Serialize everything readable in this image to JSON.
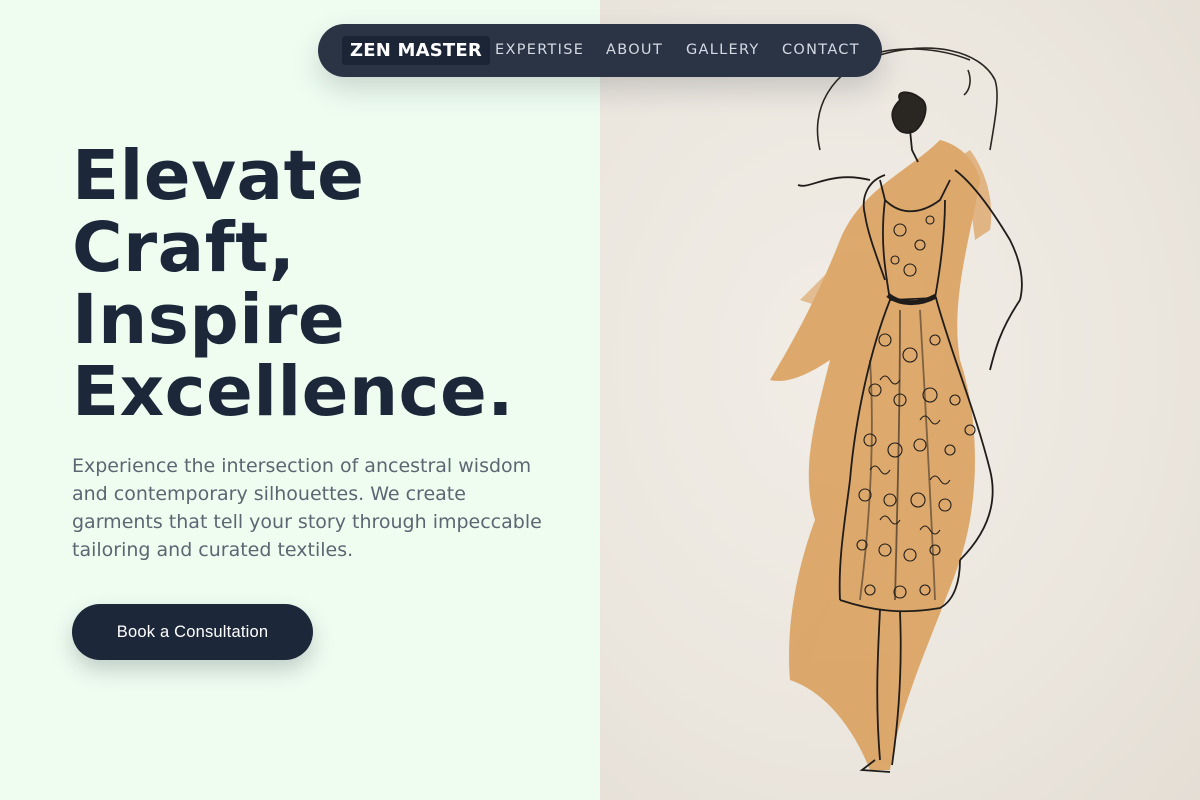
{
  "nav": {
    "logo": "ZEN MASTER",
    "links": [
      "EXPERTISE",
      "ABOUT",
      "GALLERY",
      "CONTACT"
    ]
  },
  "hero": {
    "title_lines": [
      "Elevate",
      "Craft,",
      "Inspire",
      "Excellence."
    ],
    "description": "Experience the intersection of ancestral wisdom and contemporary silhouettes. We create garments that tell your story through impeccable tailoring and curated textiles.",
    "cta_label": "Book a Consultation"
  },
  "image": {
    "subject": "fashion-sketch-of-woman-in-lace-dress-with-wide-brim-hat"
  },
  "colors": {
    "accent_dark": "#1c2739",
    "nav_bg": "#2a3445",
    "left_bg": "#effdf1",
    "right_bg": "#ebe6de",
    "watercolor": "#d99a52"
  }
}
